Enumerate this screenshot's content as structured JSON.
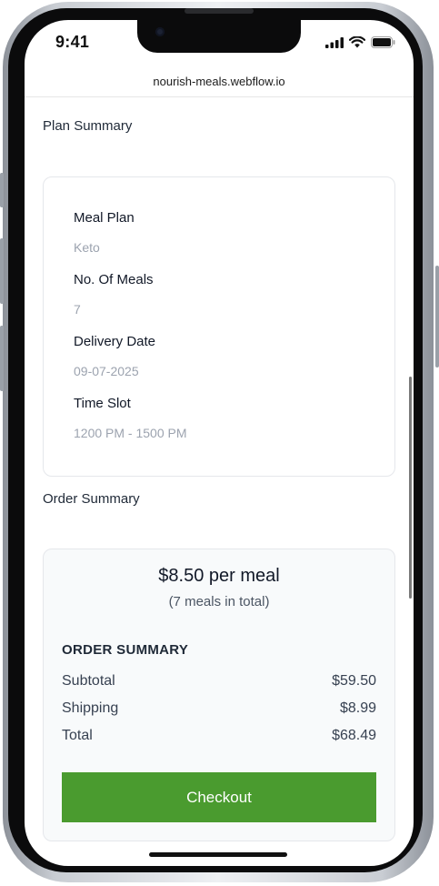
{
  "status_bar": {
    "time": "9:41",
    "icons": [
      "signal-icon",
      "wifi-icon",
      "battery-icon"
    ]
  },
  "browser": {
    "url": "nourish-meals.webflow.io"
  },
  "plan_summary": {
    "title": "Plan Summary",
    "fields": [
      {
        "label": "Meal Plan",
        "value": "Keto"
      },
      {
        "label": "No. Of Meals",
        "value": "7"
      },
      {
        "label": "Delivery Date",
        "value": "09-07-2025"
      },
      {
        "label": "Time Slot",
        "value": "1200 PM - 1500 PM"
      }
    ]
  },
  "order_summary": {
    "title": "Order Summary",
    "price_per_meal": "$8.50 per meal",
    "meals_total_note": "(7 meals in total)",
    "heading": "ORDER SUMMARY",
    "rows": [
      {
        "label": "Subtotal",
        "value": "$59.50"
      },
      {
        "label": "Shipping",
        "value": "$8.99"
      },
      {
        "label": "Total",
        "value": "$68.49"
      }
    ],
    "checkout_label": "Checkout"
  },
  "colors": {
    "accent_green": "#4a9b2f",
    "label_text": "#111827",
    "muted_text": "#9ca3af",
    "card_border": "#e5e7eb"
  }
}
